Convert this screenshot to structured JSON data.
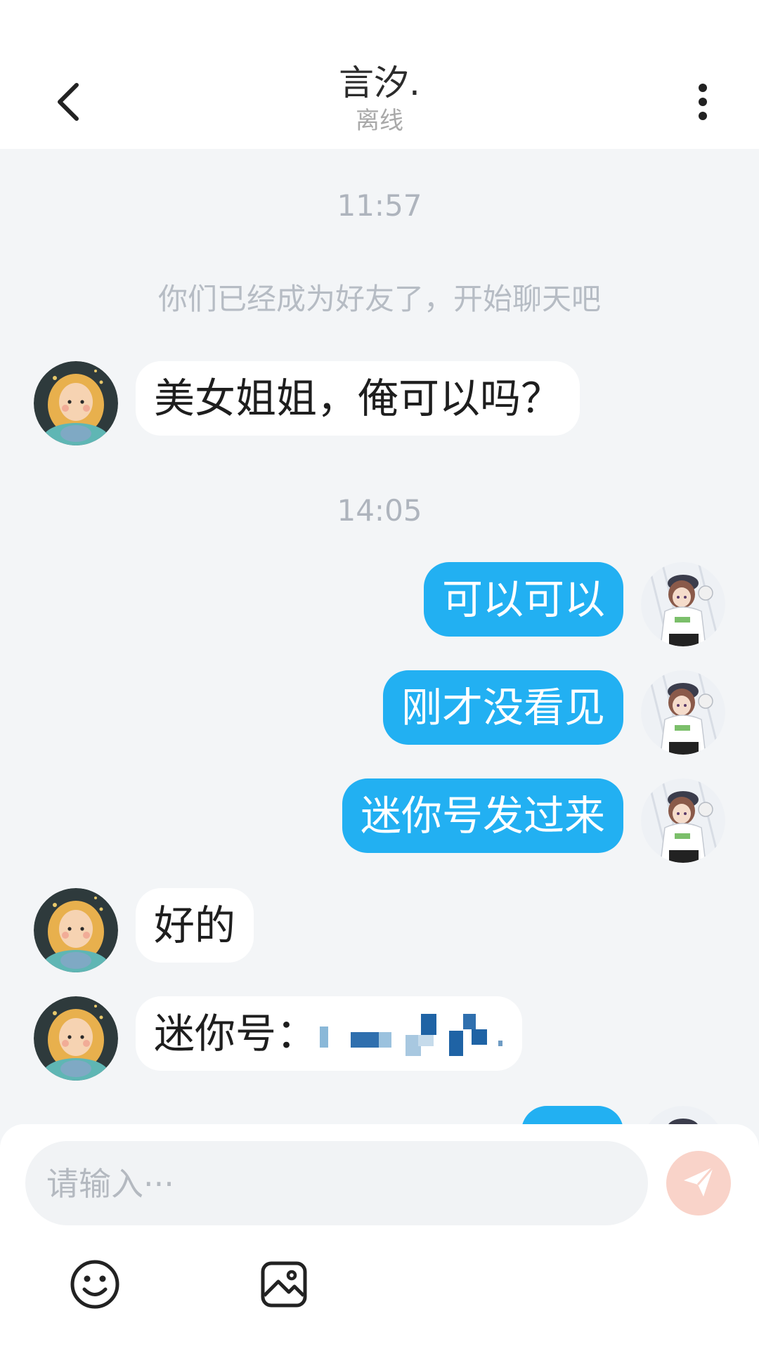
{
  "header": {
    "title": "言汐.",
    "subtitle": "离线",
    "back_icon": "chevron-left-icon",
    "more_icon": "more-vertical-icon"
  },
  "chat": {
    "time_1": "11:57",
    "system_note": "你们已经成为好友了，开始聊天吧",
    "msg_in_1": "美女姐姐，俺可以吗？",
    "time_2": "14:05",
    "msg_out_1": "可以可以",
    "msg_out_2": "刚才没看见",
    "msg_out_3": "迷你号发过来",
    "msg_in_2": "好的",
    "msg_in_3": "迷你号："
  },
  "input": {
    "placeholder": "请输入···",
    "send_icon": "paper-plane-icon",
    "emoji_icon": "smiley-icon",
    "image_icon": "image-icon"
  },
  "colors": {
    "outgoing_bubble": "#22b0f2",
    "incoming_bubble": "#ffffff",
    "chat_background": "#f3f5f7",
    "send_button": "#f9d3c9"
  }
}
